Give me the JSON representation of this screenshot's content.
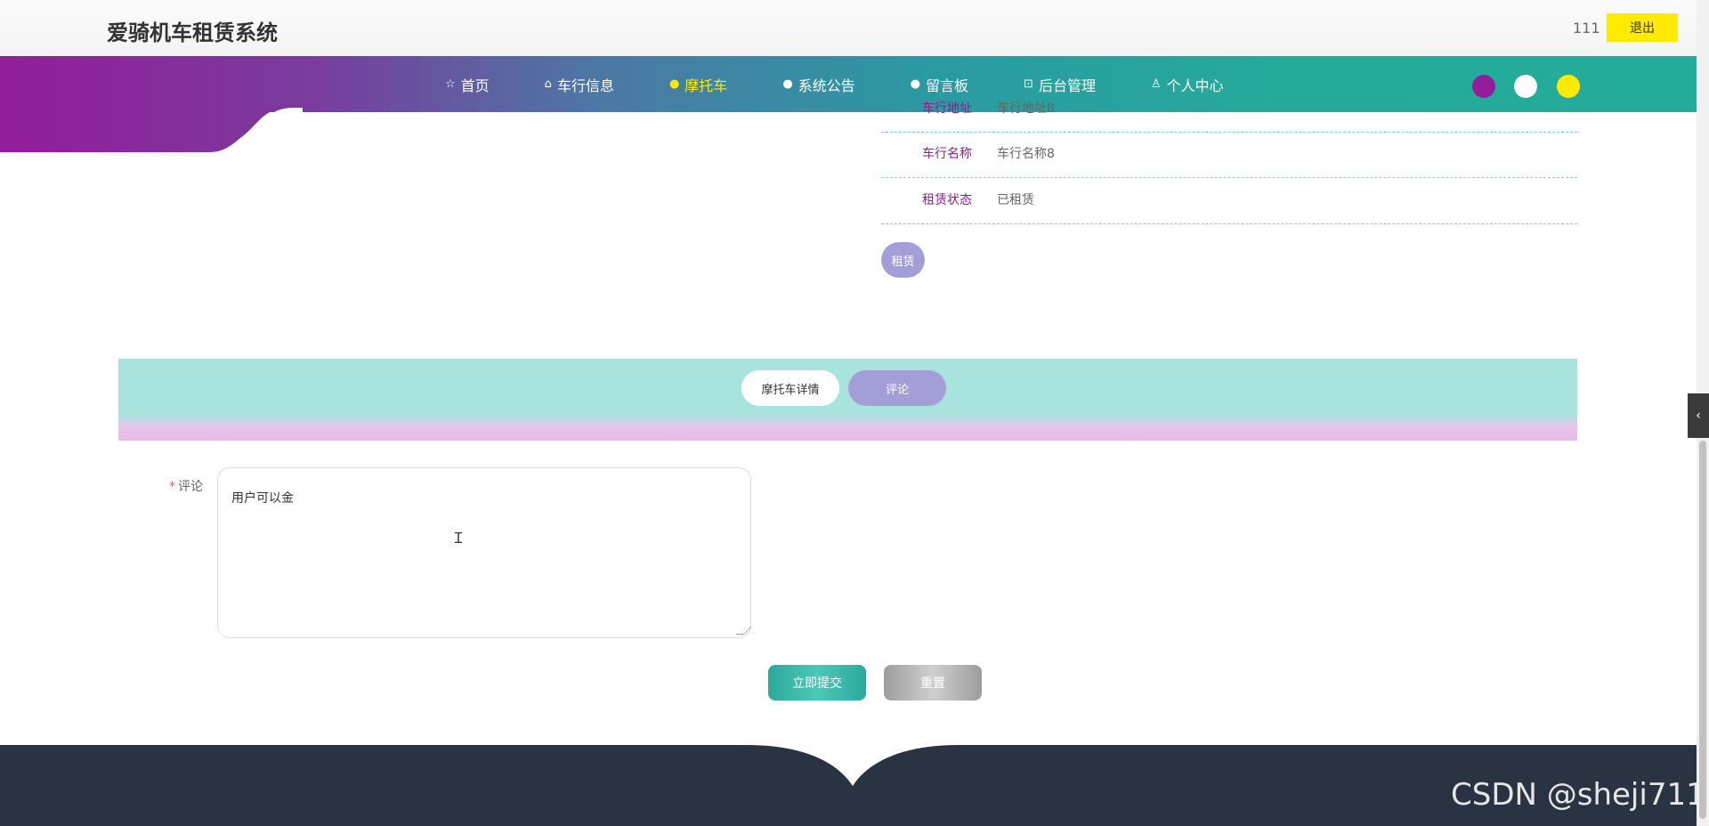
{
  "header": {
    "site_title": "爱骑机车租赁系统",
    "user_name": "111",
    "logout_label": "退出"
  },
  "nav": {
    "items": [
      {
        "label": "首页",
        "icon": "star-icon",
        "glyph": "☆",
        "active": false
      },
      {
        "label": "车行信息",
        "icon": "shop-icon",
        "glyph": "⌂",
        "active": false
      },
      {
        "label": "摩托车",
        "icon": "info-circle-icon",
        "glyph": "●",
        "active": true
      },
      {
        "label": "系统公告",
        "icon": "help-circle-icon",
        "glyph": "●",
        "active": false
      },
      {
        "label": "留言板",
        "icon": "info-circle-icon",
        "glyph": "●",
        "active": false
      },
      {
        "label": "后台管理",
        "icon": "briefcase-icon",
        "glyph": "⊡",
        "active": false
      },
      {
        "label": "个人中心",
        "icon": "user-icon",
        "glyph": "♙",
        "active": false
      }
    ],
    "theme_colors": [
      "#931d9a",
      "#ffffff",
      "#ffea00"
    ]
  },
  "details": {
    "rows": [
      {
        "label": "车行地址",
        "value": "车行地址8"
      },
      {
        "label": "车行名称",
        "value": "车行名称8"
      },
      {
        "label": "租赁状态",
        "value": "已租赁"
      }
    ],
    "rent_label": "租赁"
  },
  "tabs": {
    "detail_label": "摩托车详情",
    "comment_label": "评论"
  },
  "form": {
    "required_mark": "*",
    "comment_label": "评论",
    "comment_value": "用户可以金",
    "submit_label": "立即提交",
    "reset_label": "重置"
  },
  "watermark": "CSDN @sheji711"
}
